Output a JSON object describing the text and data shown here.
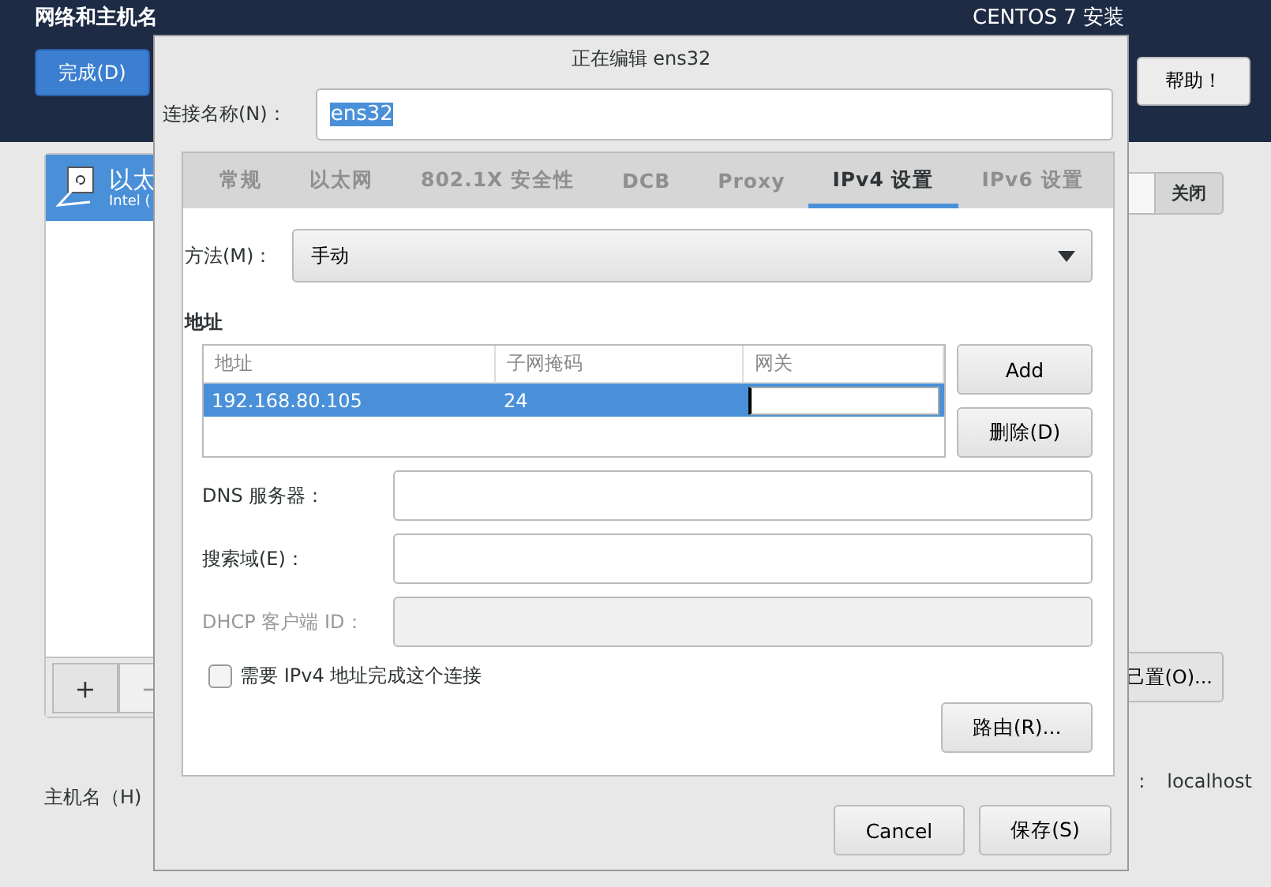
{
  "background": {
    "title": "网络和主机名",
    "done_button": "完成(D)",
    "installer_title": "CENTOS 7 安装",
    "help_button": "帮助！",
    "devices": [
      {
        "name": "以太",
        "detail": "Intel (",
        "selected": true
      }
    ],
    "add_button": "+",
    "remove_button": "−",
    "switch": {
      "label": "关闭",
      "on": false
    },
    "configure_button": "己置(O)...",
    "hostname_label": "主机名（H)",
    "hostname_colon": ":",
    "hostname_value": "localhost"
  },
  "dialog": {
    "title": "正在编辑 ens32",
    "name_label": "连接名称(N)：",
    "name_value": "ens32",
    "tabs": [
      {
        "label": "常规",
        "selected": false
      },
      {
        "label": "以太网",
        "selected": false
      },
      {
        "label": "802.1X 安全性",
        "selected": false
      },
      {
        "label": "DCB",
        "selected": false
      },
      {
        "label": "Proxy",
        "selected": false
      },
      {
        "label": "IPv4 设置",
        "selected": true
      },
      {
        "label": "IPv6 设置",
        "selected": false
      }
    ],
    "method_label": "方法(M)：",
    "method_value": "手动",
    "address_heading": "地址",
    "address_table": {
      "columns": [
        "地址",
        "子网掩码",
        "网关"
      ],
      "rows": [
        {
          "cells": [
            "192.168.80.105",
            "24"
          ],
          "selected": true,
          "editing_last": true
        }
      ]
    },
    "add_button": "Add",
    "delete_button": "删除(D)",
    "fields": [
      {
        "label": "DNS 服务器：",
        "disabled": false
      },
      {
        "label": "搜索域(E)：",
        "disabled": false
      },
      {
        "label": "DHCP 客户端 ID：",
        "disabled": true
      }
    ],
    "require_ipv4": {
      "label": "需要 IPv4 地址完成这个连接",
      "checked": false
    },
    "routes_button": "路由(R)...",
    "cancel_button": "Cancel",
    "save_button": "保存(S)"
  }
}
